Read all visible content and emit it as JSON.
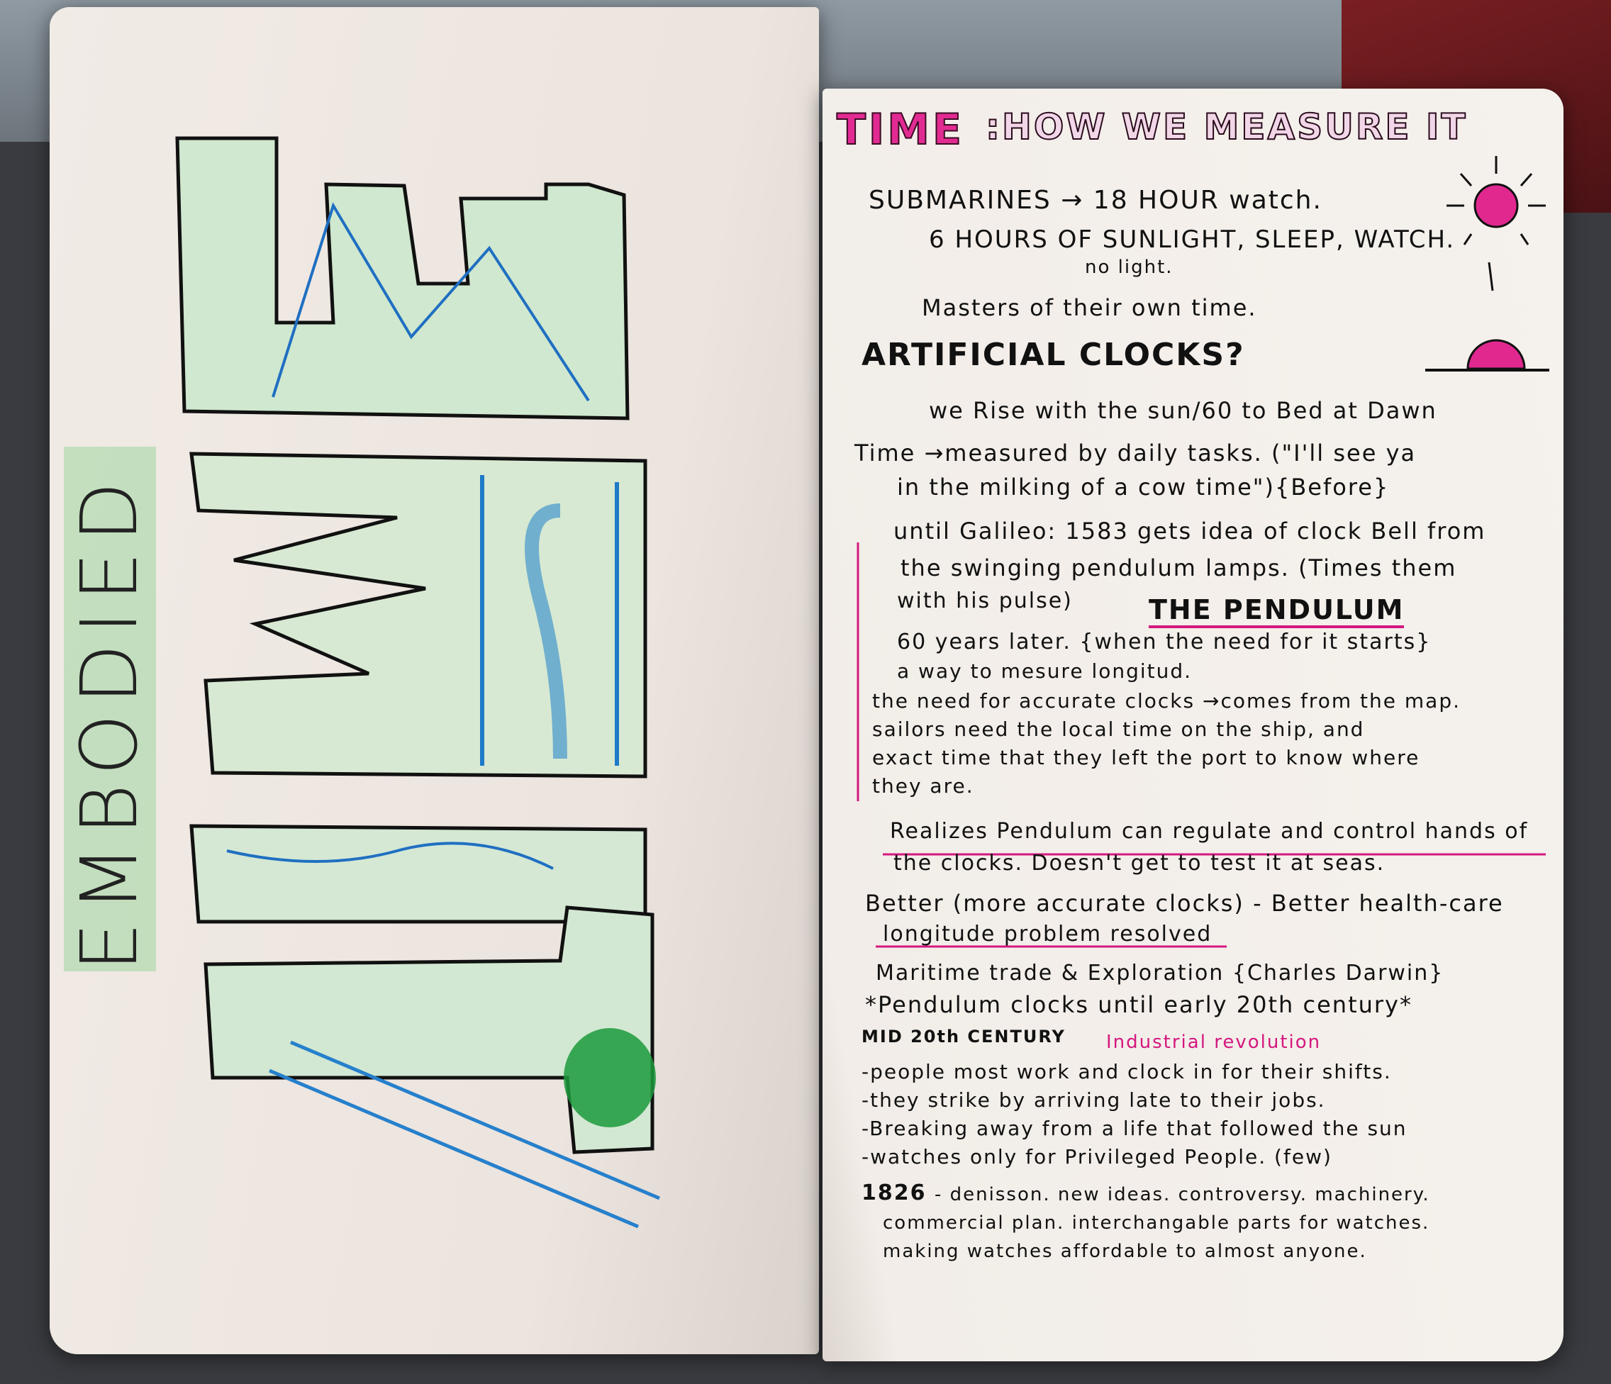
{
  "left_page": {
    "vertical_word": "EMBODIED",
    "big_word_letters": "TIME"
  },
  "right_page": {
    "title_time": "TIME",
    "title_rest": ":HOW WE MEASURE IT",
    "lines": [
      "SUBMARINES → 18 HOUR watch.",
      "6 HOURS OF  SUNLIGHT, SLEEP, WATCH.",
      "no light.",
      "Masters of their own time.",
      "ARTIFICIAL CLOCKS?",
      "we Rise with the sun/60 to Bed at Dawn",
      "Time →measured by daily tasks. (\"I'll see ya",
      "in the milking of a cow time\"){Before}",
      "until Galileo: 1583 gets idea of clock Bell from",
      "the swinging pendulum lamps. (Times them",
      "with his pulse)",
      "THE PENDULUM",
      "60 years later. {when the need for it starts}",
      "a way to mesure longitud.",
      "the need for accurate clocks →comes from the map.",
      "sailors need the local time on the ship, and",
      "exact time that they left the port to know where",
      "they are.",
      "Realizes Pendulum can regulate and control hands of",
      "the clocks. Doesn't get to test it at seas.",
      "Better (more accurate clocks) - Better health-care",
      "longitude problem resolved",
      "Maritime trade & Exploration {Charles Darwin}",
      "*Pendulum clocks until early 20th century*",
      "MID 20th CENTURY",
      "Industrial revolution",
      "-people most work and clock in for their shifts.",
      "-they strike by arriving late to their jobs.",
      "-Breaking away from a life that followed the sun",
      "-watches only for Privileged People. (few)",
      "1826",
      "- denisson. new ideas. controversy. machinery.",
      "commercial plan. interchangable parts for watches.",
      "making watches affordable to almost anyone."
    ]
  }
}
